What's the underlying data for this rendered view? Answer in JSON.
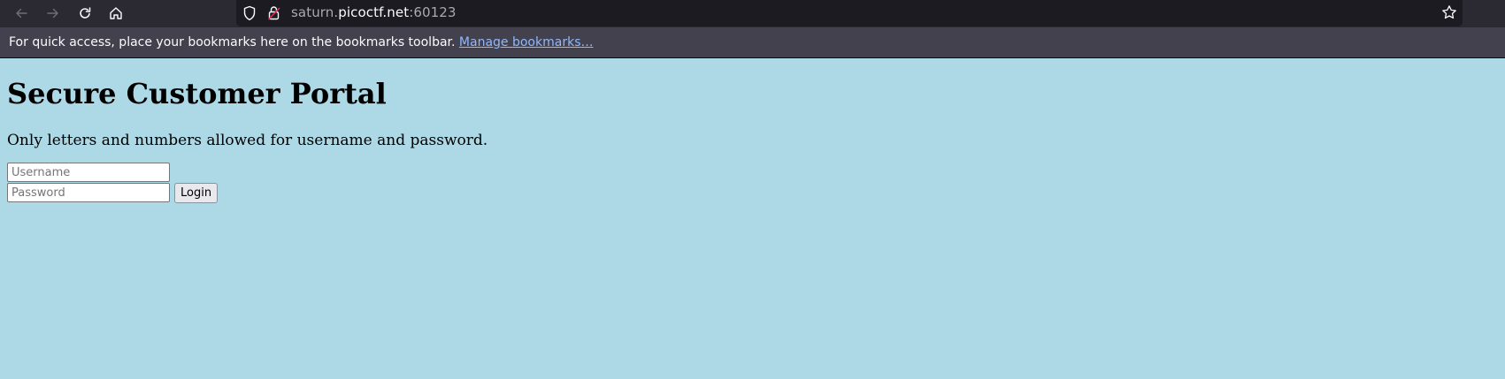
{
  "browser": {
    "url_subdomain": "saturn.",
    "url_domain": "picoctf.net",
    "url_port": ":60123",
    "bookmarks_message": "For quick access, place your bookmarks here on the bookmarks toolbar. ",
    "manage_bookmarks_label": "Manage bookmarks…",
    "icons": [
      "back-arrow-icon",
      "forward-arrow-icon",
      "reload-icon",
      "home-icon",
      "shield-icon",
      "insecure-lock-icon",
      "star-icon"
    ],
    "colors": {
      "toolbar": "#2b2a33",
      "urlbar": "#1c1b22",
      "bookmarks_bar": "#42414d",
      "link": "#8fb8ff"
    }
  },
  "page": {
    "title": "Secure Customer Portal",
    "note": "Only letters and numbers allowed for username and password.",
    "username": {
      "value": "",
      "placeholder": "Username"
    },
    "password": {
      "value": "",
      "placeholder": "Password"
    },
    "login_label": "Login",
    "background_color": "#add8e6"
  }
}
